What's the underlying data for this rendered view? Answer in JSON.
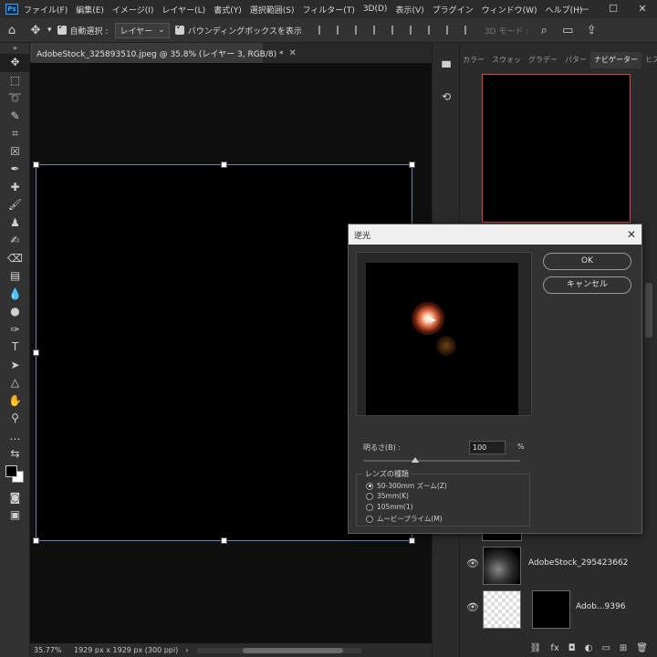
{
  "menubar": {
    "logo": "Ps",
    "items": [
      "ファイル(F)",
      "編集(E)",
      "イメージ(I)",
      "レイヤー(L)",
      "書式(Y)",
      "選択範囲(S)",
      "フィルター(T)",
      "3D(D)",
      "表示(V)",
      "プラグイン",
      "ウィンドウ(W)",
      "ヘルプ(H)"
    ],
    "window_controls": [
      "minimize-icon",
      "maximize-icon",
      "close-icon"
    ]
  },
  "options_bar": {
    "auto_select_label": "自動選択 :",
    "auto_select_value": "レイヤー",
    "bounding_box_label": "バウンディングボックスを表示",
    "mode_3d_label": "3D モード :"
  },
  "document": {
    "tab_title": "AdobeStock_325893510.jpeg @ 35.8% (レイヤー 3, RGB/8) *",
    "zoom": "35.77%",
    "size": "1929 px x 1929 px (300 ppi)"
  },
  "panels": {
    "tabs": [
      "カラー",
      "スウォッ",
      "グラデー",
      "パター",
      "ナビゲーター",
      "ヒストリ"
    ],
    "active_tab": "ナビゲーター"
  },
  "layers": [
    {
      "name": "AdobeStock_295423662"
    },
    {
      "name": "Adob...9396"
    }
  ],
  "dialog": {
    "title": "逆光",
    "ok_label": "OK",
    "cancel_label": "キャンセル",
    "brightness_label": "明るさ(B) :",
    "brightness_value": "100",
    "brightness_unit": "%",
    "brightness_slider": 0.33,
    "lens_group_label": "レンズの種類",
    "lens_options": [
      "50-300mm ズーム(Z)",
      "35mm(K)",
      "105mm(1)",
      "ムービープライム(M)"
    ],
    "lens_selected": "50-300mm ズーム(Z)"
  },
  "colors": {
    "selection_border": "#6d7fb4",
    "navigator_view": "#e0473c",
    "flare_core": "#ffffff",
    "flare_glow": "#e06a40"
  }
}
